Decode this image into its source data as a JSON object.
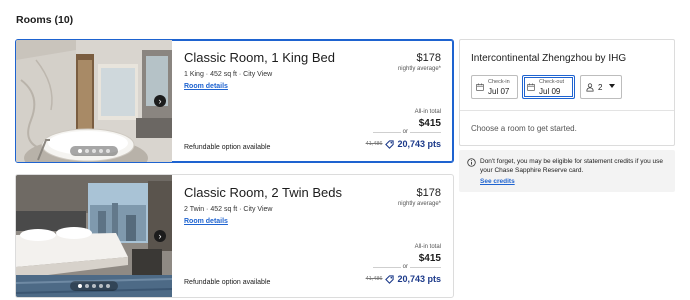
{
  "heading": "Rooms (10)",
  "rooms": [
    {
      "title": "Classic Room, 1 King Bed",
      "meta": "1 King  ·  452 sq ft  ·  City View",
      "details_link": "Room details",
      "price_nightly": "$178",
      "price_nightly_label": "nightly average*",
      "allin_label": "All-in total",
      "allin_price": "$415",
      "or": "or",
      "pts_old": "41,486",
      "pts_value": "20,743 pts",
      "refundable": "Refundable option available",
      "photo_dots": 5,
      "selected": true
    },
    {
      "title": "Classic Room, 2 Twin Beds",
      "meta": "2 Twin  ·  452 sq ft  ·  City View",
      "details_link": "Room details",
      "price_nightly": "$178",
      "price_nightly_label": "nightly average*",
      "allin_label": "All-in total",
      "allin_price": "$415",
      "or": "or",
      "pts_old": "41,486",
      "pts_value": "20,743 pts",
      "refundable": "Refundable option available",
      "photo_dots": 5,
      "selected": false
    }
  ],
  "panel": {
    "hotel_name": "Intercontinental Zhengzhou by IHG",
    "checkin_label": "Check-in",
    "checkin_value": "Jul 07",
    "checkout_label": "Check-out",
    "checkout_value": "Jul 09",
    "guests_value": "2",
    "choose_text": "Choose a room to get started."
  },
  "notice": {
    "text": "Don't forget, you may be eligible for statement credits if you use your Chase Sapphire Reserve card.",
    "link": "See credits"
  },
  "colors": {
    "accent": "#1e63d0",
    "points": "#1c3a8a",
    "border": "#dcdcdc",
    "notice_bg": "#f3f3f3"
  }
}
